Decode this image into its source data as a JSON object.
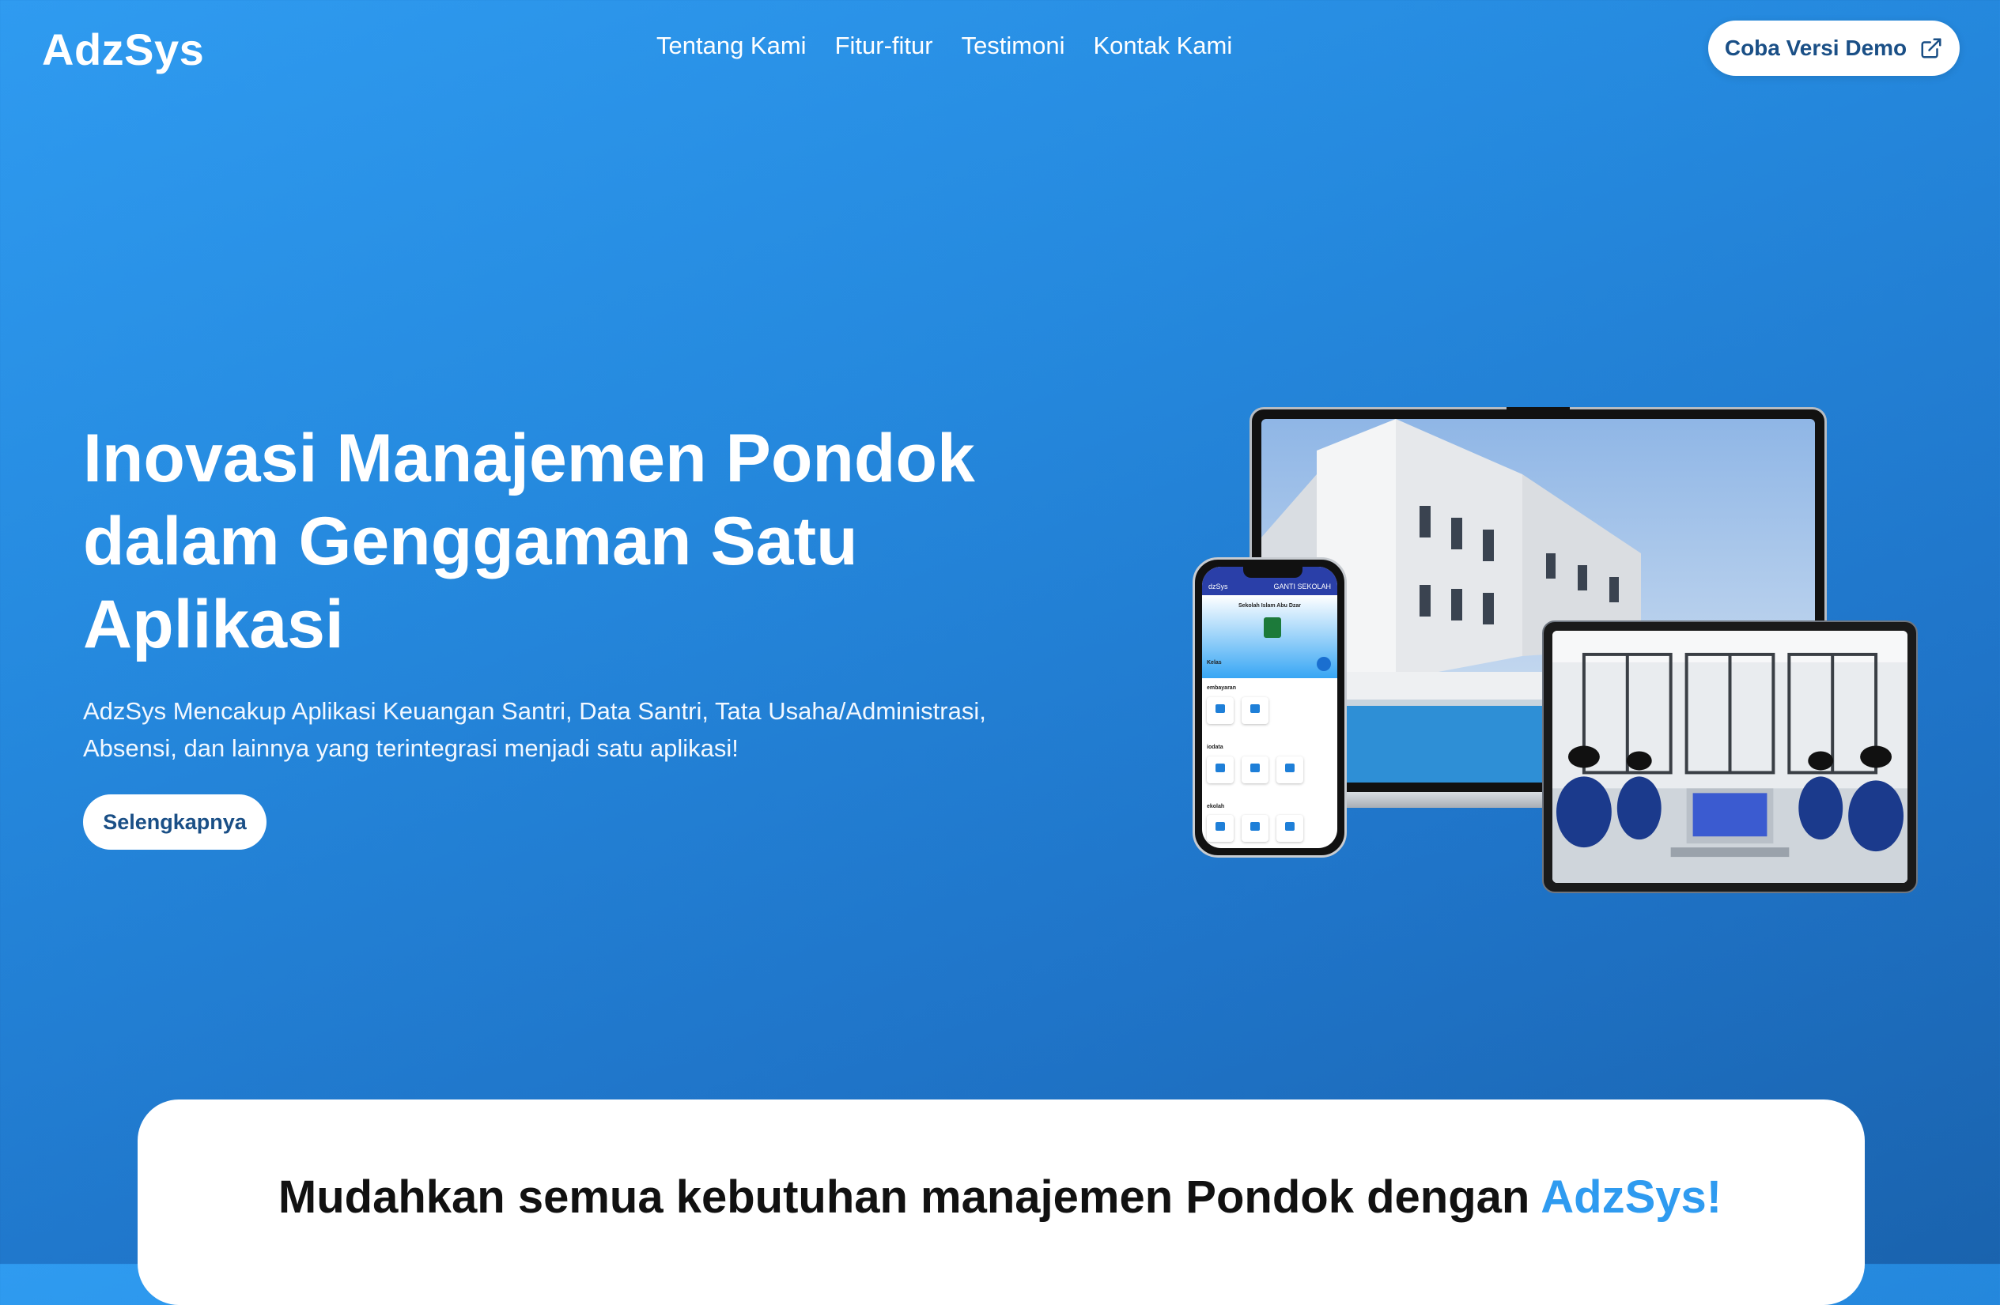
{
  "nav": {
    "logo": "AdzSys",
    "links": [
      "Tentang Kami",
      "Fitur-fitur",
      "Testimoni",
      "Kontak Kami"
    ],
    "demo_button": "Coba Versi Demo",
    "demo_icon": "external-link-icon"
  },
  "hero": {
    "title": "Inovasi Manajemen Pondok dalam Genggaman Satu Aplikasi",
    "subtitle": "AdzSys Mencakup Aplikasi Keuangan Santri, Data Santri, Tata Usaha/Administrasi, Absensi, dan lainnya yang terintegrasi menjadi satu aplikasi!",
    "cta": "Selengkapnya"
  },
  "mockup_phone": {
    "app_name": "dzSys",
    "bar_right": "GANTI SEKOLAH",
    "school": "Sekolah Islam Abu Dzar",
    "sections": [
      "Kelas",
      "embayaran",
      "iodata",
      "ekolah"
    ]
  },
  "section": {
    "title_prefix": "Mudahkan semua kebutuhan manajemen Pondok dengan ",
    "title_accent": "AdzSys!"
  },
  "colors": {
    "accent": "#2f9bf0",
    "button_text": "#1a4f86",
    "bg_start": "#2f9bf0",
    "bg_end": "#1a63ae"
  }
}
